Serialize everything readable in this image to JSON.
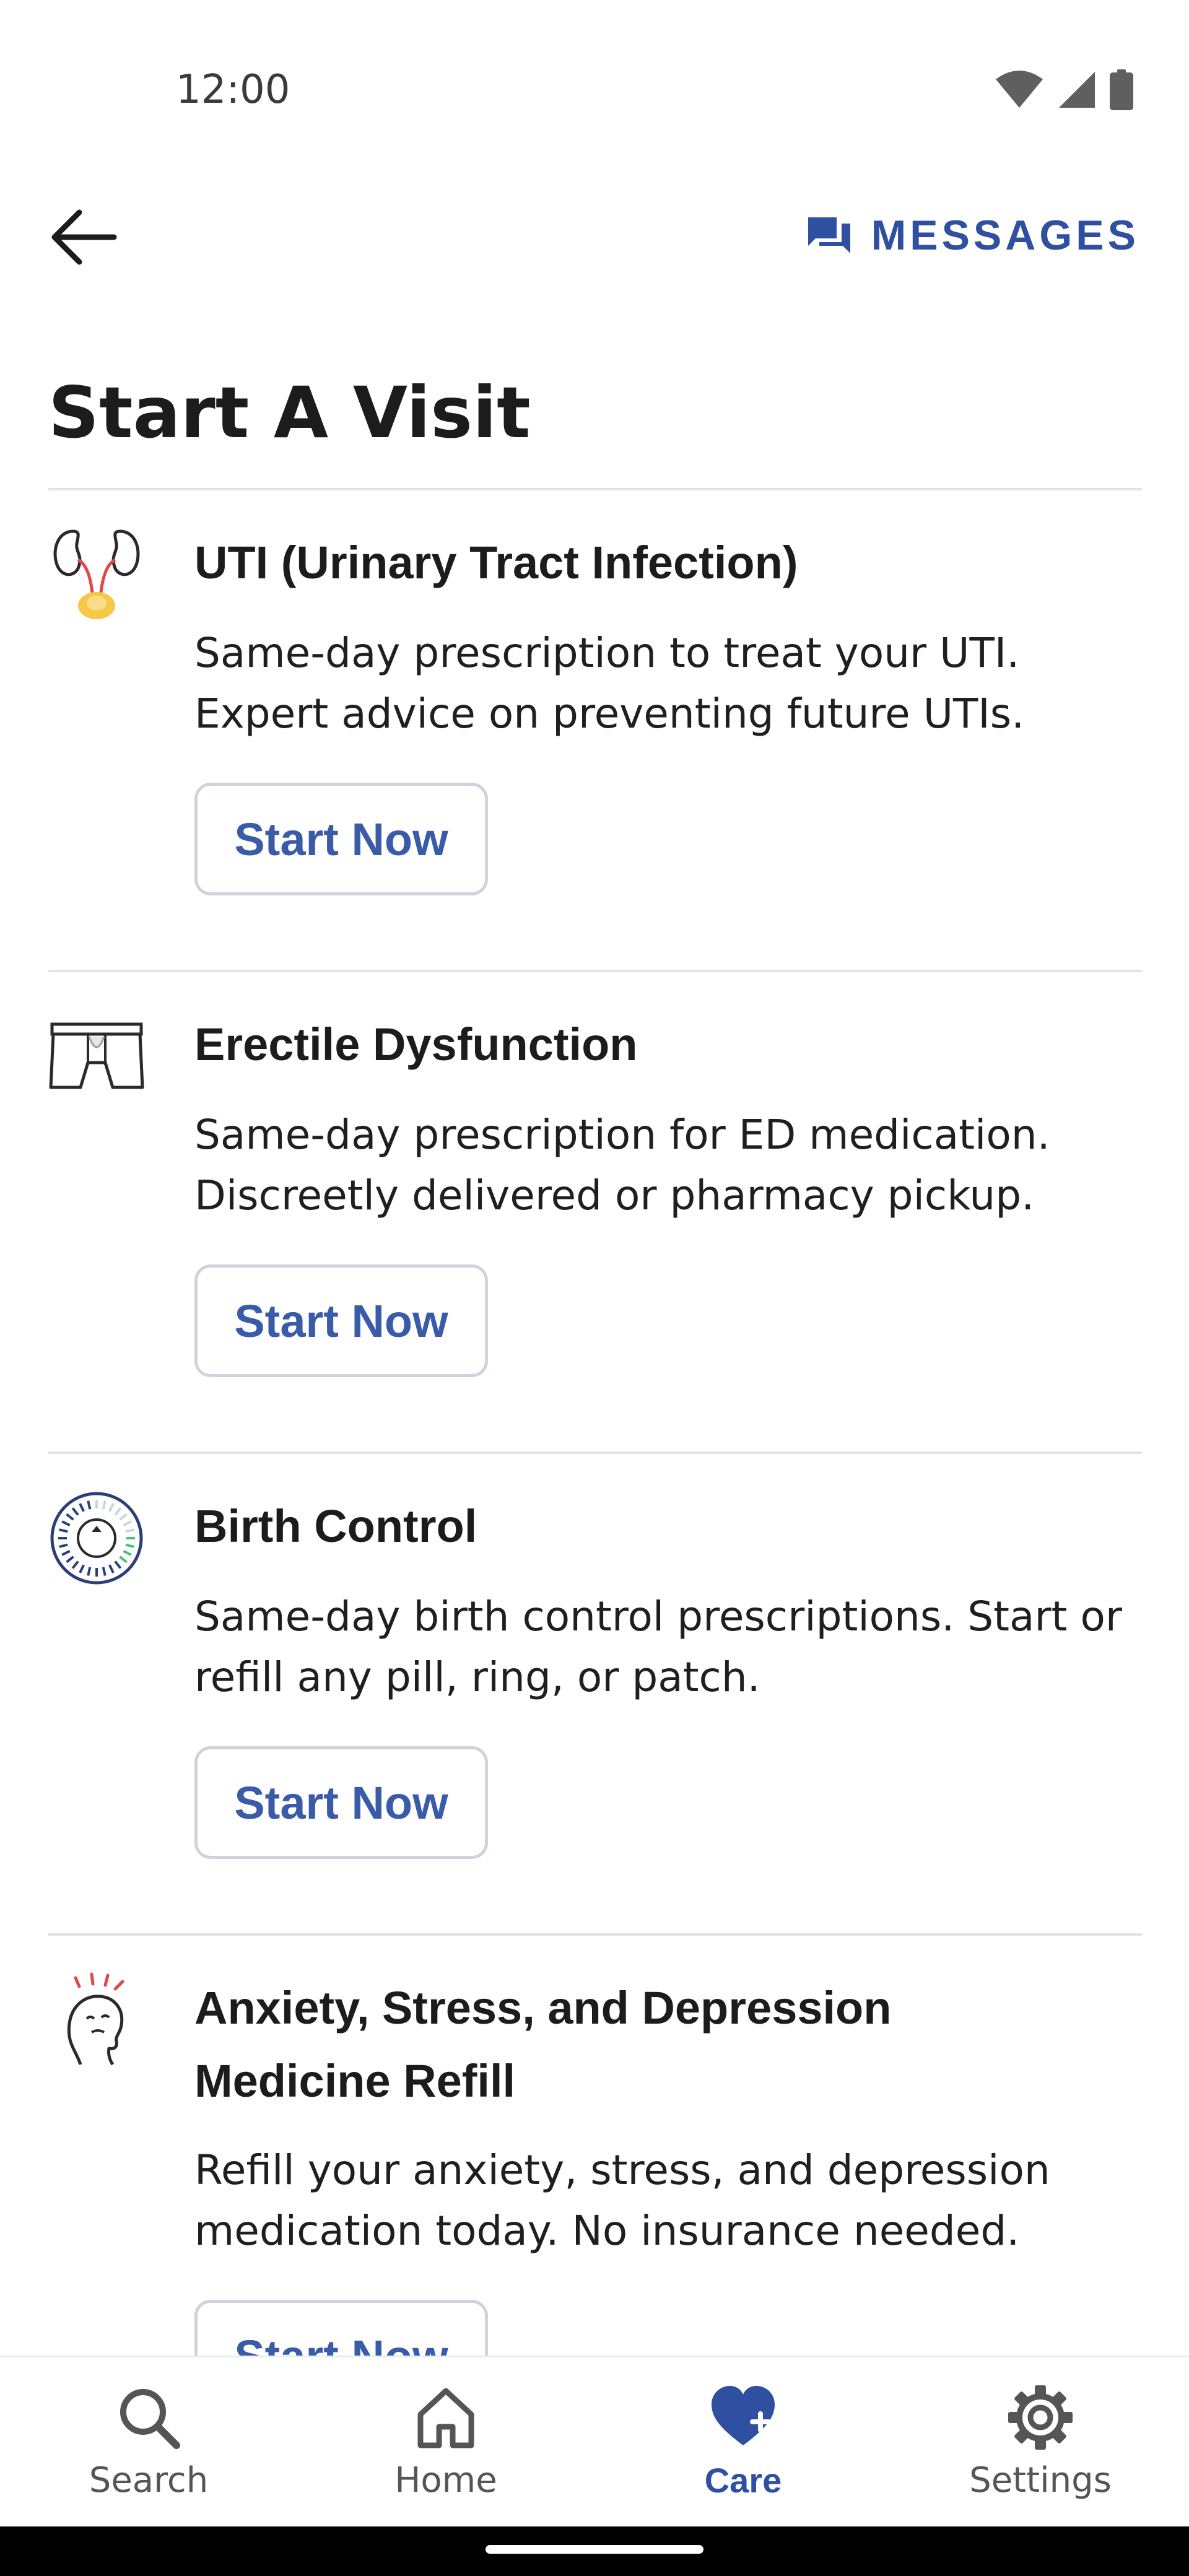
{
  "status_bar": {
    "time": "12:00"
  },
  "header": {
    "messages_label": "MESSAGES"
  },
  "page_title": "Start A Visit",
  "cards": [
    {
      "icon": "kidneys-icon",
      "title": "UTI (Urinary Tract Infection)",
      "description_lines": [
        "Same-day prescription to treat your UTI.",
        "Expert advice on preventing future UTIs."
      ],
      "button_label": "Start Now"
    },
    {
      "icon": "underwear-icon",
      "title": "Erectile Dysfunction",
      "description_lines": [
        "Same-day prescription for ED medication.",
        "Discreetly delivered or pharmacy pickup."
      ],
      "button_label": "Start Now"
    },
    {
      "icon": "pill-pack-icon",
      "title": "Birth Control",
      "description_lines": [
        "Same-day birth control prescriptions. Start or",
        "refill any pill, ring, or patch."
      ],
      "button_label": "Start Now"
    },
    {
      "icon": "stressed-head-icon",
      "title_lines": [
        "Anxiety, Stress, and Depression",
        "Medicine Refill"
      ],
      "description_lines": [
        "Refill your anxiety, stress, and depression",
        "medication today. No insurance needed."
      ],
      "button_label": "Start Now"
    }
  ],
  "bottom_nav": {
    "items": [
      {
        "label": "Search",
        "icon": "search-icon",
        "active": false
      },
      {
        "label": "Home",
        "icon": "home-icon",
        "active": false
      },
      {
        "label": "Care",
        "icon": "heart-plus-icon",
        "active": true
      },
      {
        "label": "Settings",
        "icon": "gear-icon",
        "active": false
      }
    ]
  },
  "colors": {
    "accent": "#2f4fa0",
    "button_text": "#3a5ca8",
    "divider": "#e3e3e3"
  }
}
